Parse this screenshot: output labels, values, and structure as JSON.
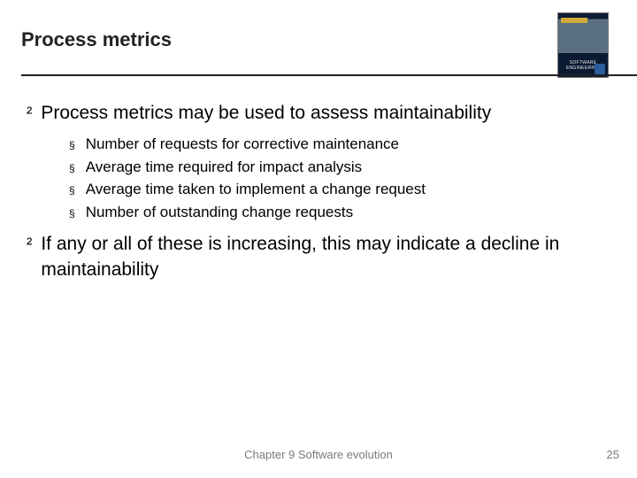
{
  "slide": {
    "title": "Process metrics",
    "cover_label": "SOFTWARE ENGINEERING",
    "bullets": [
      {
        "text": "Process metrics may be used to assess maintainability",
        "sub": [
          "Number of requests for corrective maintenance",
          "Average time required for impact analysis",
          "Average time taken to implement a change request",
          "Number of outstanding change requests"
        ]
      },
      {
        "text": "If any or all of these is increasing, this may indicate a decline in maintainability",
        "sub": []
      }
    ],
    "footer": {
      "center": "Chapter 9 Software evolution",
      "page": "25"
    },
    "markers": {
      "level1": "²",
      "level2": "§"
    }
  }
}
